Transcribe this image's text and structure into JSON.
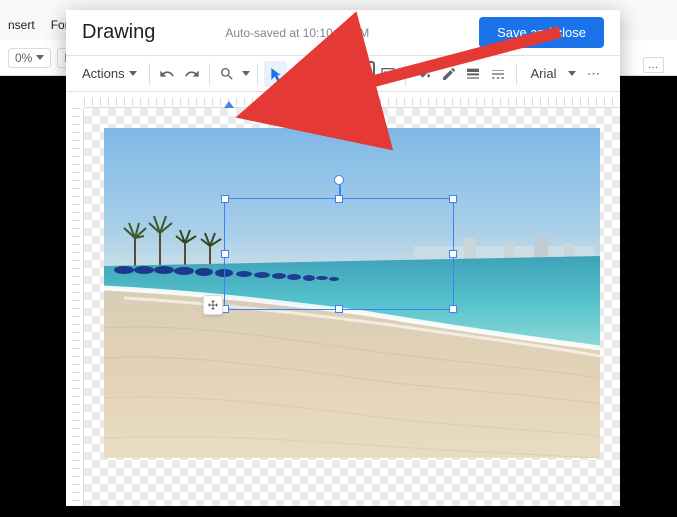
{
  "bg_menu": {
    "insert": "nsert",
    "format": "Form"
  },
  "bg_toolbar": {
    "zoom": "0%",
    "style": "Nor"
  },
  "modal": {
    "title": "Drawing",
    "autosave": "Auto-saved at 10:10:11 AM",
    "save_btn": "Save and close"
  },
  "drawing_toolbar": {
    "actions": "Actions",
    "font": "Arial"
  }
}
